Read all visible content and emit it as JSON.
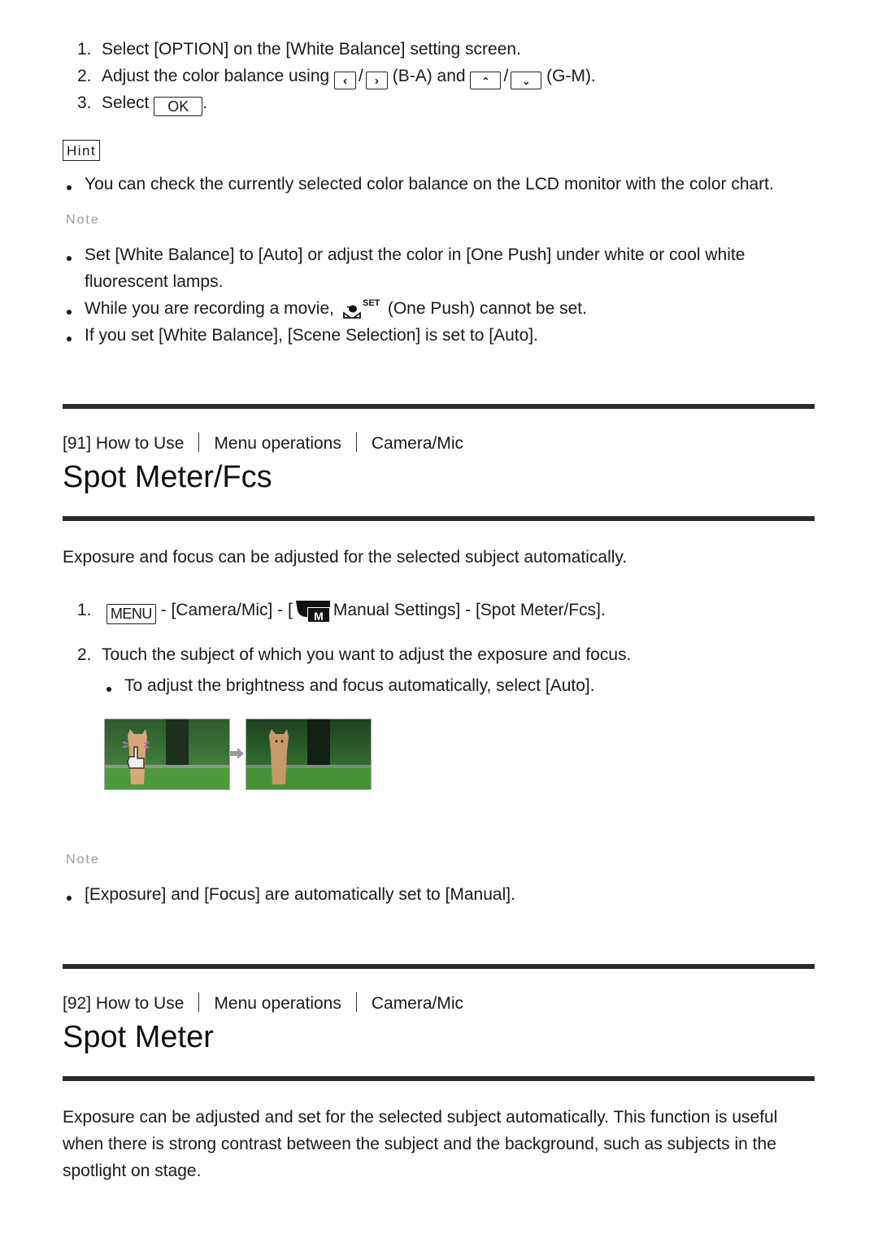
{
  "wb_section": {
    "steps": [
      {
        "num": "1.",
        "text": "Select [OPTION] on the [White Balance] setting screen."
      },
      {
        "num": "2.",
        "pre": "Adjust the color balance using",
        "slash": "/",
        "mid": "(B-A) and",
        "post": "(G-M)."
      },
      {
        "num": "3.",
        "pre": "Select",
        "ok_label": "OK",
        "post": "."
      }
    ],
    "icons": {
      "left": "chevron-left-icon",
      "right": "chevron-right-icon",
      "up": "chevron-up-icon",
      "down": "chevron-down-icon"
    },
    "hint_label": "Hint",
    "hint_items": [
      "You can check the currently selected color balance on the LCD monitor with the color chart."
    ],
    "note_label": "Note",
    "note_items": [
      {
        "text": "Set [White Balance] to [Auto] or adjust the color in [One Push] under white or cool white",
        "text2": "fluorescent lamps."
      },
      {
        "pre": "While you are recording a movie,",
        "icon_label": "SET",
        "post": "(One Push) cannot be set."
      },
      {
        "text": "If you set [White Balance], [Scene Selection] is set to [Auto]."
      }
    ]
  },
  "section91": {
    "breadcrumb": [
      "[91] How to Use",
      "Menu operations",
      "Camera/Mic"
    ],
    "title": "Spot Meter/Fcs",
    "intro": "Exposure and focus can be adjusted for the selected subject automatically.",
    "step1": {
      "num": "1.",
      "menu_label": "MENU",
      "pre": "- [Camera/Mic] - [",
      "icon_label": "M",
      "post": "Manual Settings] - [Spot Meter/Fcs]."
    },
    "step2": {
      "num": "2.",
      "text": "Touch the subject of which you want to adjust the exposure and focus."
    },
    "step2_sub": "To adjust the brightness and focus automatically, select [Auto].",
    "images": [
      "kitten-touch-before",
      "kitten-adjusted-after"
    ],
    "note_label": "Note",
    "note_items": [
      "[Exposure] and [Focus] are automatically set to [Manual]."
    ]
  },
  "section92": {
    "breadcrumb": [
      "[92] How to Use",
      "Menu operations",
      "Camera/Mic"
    ],
    "title": "Spot Meter",
    "intro_lines": [
      "Exposure can be adjusted and set for the selected subject automatically. This function is useful",
      "when there is strong contrast between the subject and the background, such as subjects in the",
      "spotlight on stage."
    ]
  }
}
